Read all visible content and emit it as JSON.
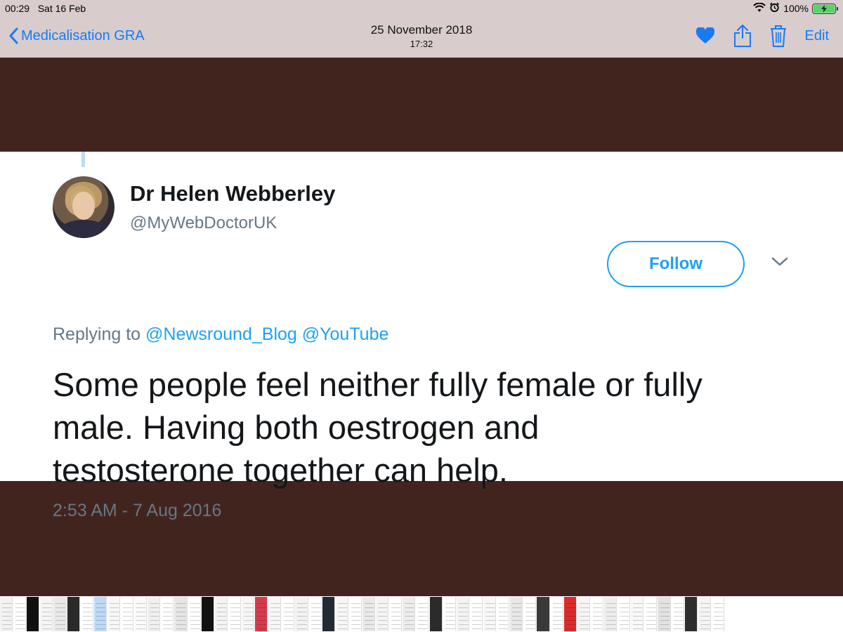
{
  "status_bar": {
    "time": "00:29",
    "date": "Sat 16 Feb",
    "battery": "100%"
  },
  "nav": {
    "back_label": "Medicalisation GRA",
    "title_date": "25 November 2018",
    "title_time": "17:32",
    "edit_label": "Edit",
    "accent_color": "#1a7af0"
  },
  "tweet": {
    "author_name": "Dr Helen Webberley",
    "author_handle": "@MyWebDoctorUK",
    "follow_label": "Follow",
    "replying_prefix": "Replying to",
    "reply_mentions": [
      "@Newsround_Blog",
      "@YouTube"
    ],
    "text_lines": [
      "Some people feel neither fully female or fully",
      "male. Having both oestrogen and",
      "testosterone together can help."
    ],
    "timestamp": "2:53 AM - 7 Aug 2016",
    "link_color": "#1da1f2"
  },
  "thumbnails": {
    "colors": [
      "#f2f2f2",
      "#ffffff",
      "#111111",
      "#f5f5f5",
      "#e9e9e9",
      "#2a2a2a",
      "#ffffff",
      "#bcd9f5",
      "#f7f7f7",
      "#ffffff",
      "#fafafa",
      "#f0f0f0",
      "#ffffff",
      "#e5e5e5",
      "#ffffff",
      "#111111",
      "#f3f3f3",
      "#ffffff",
      "#f6f6f6",
      "#d63b4b",
      "#f7f7f7",
      "#ffffff",
      "#f2f2f2",
      "#ffffff",
      "#222a33",
      "#f6f6f6",
      "#ffffff",
      "#e9e9e9",
      "#f4f4f4",
      "#ffffff",
      "#ececec",
      "#ffffff",
      "#2b2b2b",
      "#ffffff",
      "#f3f3f3",
      "#ffffff",
      "#f7f7f7",
      "#ffffff",
      "#e7e7e7",
      "#ffffff",
      "#3a3a3a",
      "#ffffff",
      "#dc2b2b",
      "#f5f5f5",
      "#ffffff",
      "#ededed",
      "#ffffff",
      "#f8f8f8",
      "#ffffff",
      "#e2e2e2",
      "#ffffff",
      "#2e2e2e",
      "#f4f4f4",
      "#ffffff"
    ]
  }
}
